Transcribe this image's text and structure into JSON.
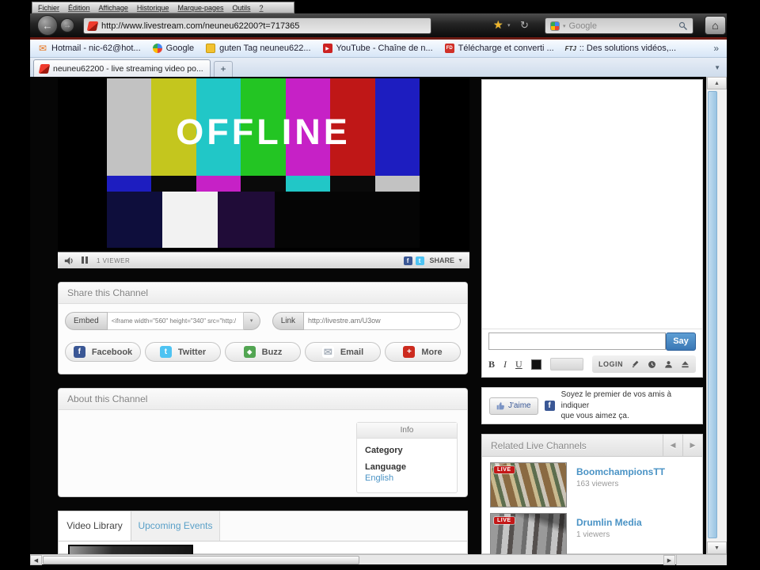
{
  "browser": {
    "menu": [
      "Fichier",
      "Édition",
      "Affichage",
      "Historique",
      "Marque-pages",
      "Outils",
      "?"
    ],
    "url": "http://www.livestream.com/neuneu62200?t=717365",
    "search_placeholder": "Google",
    "bookmarks": [
      "Hotmail - nic-62@hot...",
      "Google",
      "guten Tag neuneu622...",
      "YouTube - Chaîne de n...",
      "Télécharge et converti ...",
      ":: Des solutions vidéos,..."
    ],
    "bookmarks_overflow": "»",
    "tab_title": "neuneu62200 - live streaming video po...",
    "new_tab_label": "+",
    "tab_list_caret": "▼"
  },
  "icons": {
    "back": "←",
    "forward": "→",
    "star": "★",
    "caret_down_small": "▾",
    "reload": "↻",
    "home": "⌂",
    "envelope": "✉",
    "play": "▶",
    "fd_glyph": "FD",
    "ftj_glyph": "FTJ",
    "diamond": "◆",
    "plus": "+",
    "fb_letter": "f",
    "tw_letter": "t",
    "arrow_left": "◀",
    "arrow_right": "▶",
    "arrow_up": "▲",
    "arrow_down": "▼"
  },
  "player": {
    "offline_label": "OFFLINE",
    "viewers_label": "1 VIEWER",
    "share_label": "SHARE",
    "bar_colors": [
      "#c2c2c2",
      "#c4c61e",
      "#21c7c7",
      "#23c523",
      "#c621c6",
      "#bf1717",
      "#1d1dc0"
    ]
  },
  "share": {
    "title": "Share this Channel",
    "embed_label": "Embed",
    "embed_value": "<iframe width=\"560\" height=\"340\" src=\"http:/",
    "link_label": "Link",
    "link_value": "http://livestre.am/U3ow",
    "buttons": [
      "Facebook",
      "Twitter",
      "Buzz",
      "Email",
      "More"
    ]
  },
  "about": {
    "title": "About this Channel",
    "info_title": "Info",
    "category_label": "Category",
    "language_label": "Language",
    "language_value": "English"
  },
  "library": {
    "tab_video": "Video Library",
    "tab_events": "Upcoming Events"
  },
  "chat": {
    "say_label": "Say",
    "bold_label": "B",
    "italic_label": "I",
    "underline_label": "U",
    "login_label": "LOGIN"
  },
  "facebook_like": {
    "like_label": "J'aime",
    "text_line1": "Soyez le premier de vos amis à indiquer",
    "text_line2": "que vous aimez ça."
  },
  "related": {
    "title": "Related Live Channels",
    "channels": [
      {
        "name": "BoomchampionsTT",
        "viewers": "163 viewers",
        "badge": "LIVE"
      },
      {
        "name": "Drumlin Media",
        "viewers": "1 viewers",
        "badge": "LIVE"
      }
    ]
  },
  "colors": {
    "accent_blue_link": "#4a93c5",
    "say_button_blue": "#3a77b5",
    "facebook_blue": "#3a5795",
    "live_badge_red": "#c41818",
    "toolbar_red_line": "#6b1a12"
  }
}
